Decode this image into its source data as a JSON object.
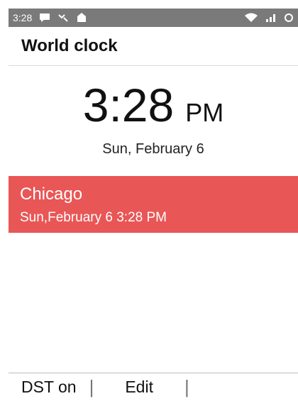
{
  "status_bar": {
    "time": "3:28",
    "icons_left": [
      "message-icon",
      "missed-call-icon",
      "notification-icon"
    ],
    "icons_right": [
      "wifi-icon",
      "signal-icon",
      "alarm-icon"
    ]
  },
  "header": {
    "title": "World clock"
  },
  "main_clock": {
    "time": "3:28",
    "ampm": "PM",
    "date": "Sun, February 6"
  },
  "city_list": [
    {
      "city": "Chicago",
      "datetime": "Sun,February 6  3:28  PM"
    }
  ],
  "bottom_bar": {
    "left_label": "DST on",
    "center_label": "Edit"
  },
  "colors": {
    "status_bar": "#7a7a7a",
    "highlight": "#e95656"
  }
}
